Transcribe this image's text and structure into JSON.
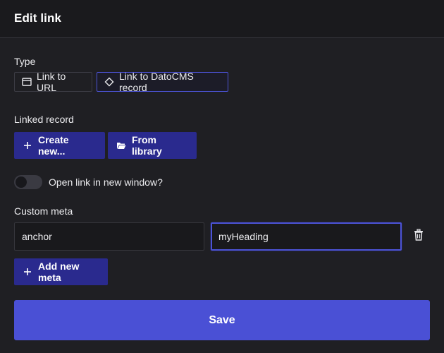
{
  "dialog": {
    "title": "Edit link"
  },
  "type": {
    "label": "Type",
    "options": [
      {
        "label": "Link to URL",
        "icon": "window-icon",
        "selected": false
      },
      {
        "label": "Link to DatoCMS record",
        "icon": "diamond-icon",
        "selected": true
      }
    ]
  },
  "linked_record": {
    "label": "Linked record",
    "create_label": "Create new...",
    "library_label": "From library"
  },
  "new_window": {
    "label": "Open link in new window?",
    "enabled": false
  },
  "custom_meta": {
    "label": "Custom meta",
    "key_value": "anchor",
    "value_value": "myHeading",
    "add_label": "Add new meta"
  },
  "actions": {
    "save_label": "Save"
  },
  "colors": {
    "accent": "#4a50d5",
    "button_dark": "#2a2a8e",
    "background": "#1f1f23"
  }
}
